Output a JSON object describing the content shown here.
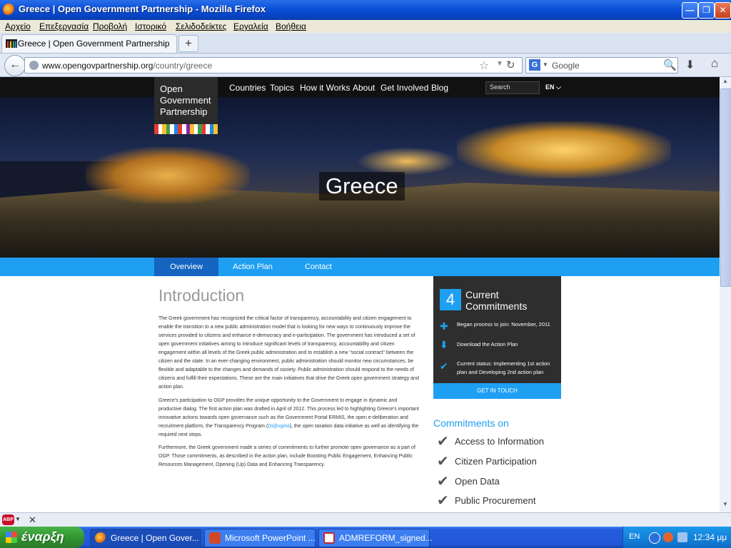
{
  "window": {
    "title": "Greece | Open Government Partnership - Mozilla Firefox",
    "controls": [
      "minimize",
      "maximize",
      "close"
    ]
  },
  "menubar": [
    "Αρχείο",
    "Επεξεργασία",
    "Προβολή",
    "Ιστορικό",
    "Σελιδοδείκτες",
    "Εργαλεία",
    "Βοήθεια"
  ],
  "tab": {
    "label": "Greece | Open Government Partnership",
    "new_tab": "+"
  },
  "navbar": {
    "url_host": "www.opengovpartnership.org",
    "url_path": "/country/greece",
    "search_placeholder": "Google",
    "search_engine": "G"
  },
  "site": {
    "logo": "Open Government Partnership",
    "nav": [
      "Countries",
      "Topics",
      "How it Works",
      "About",
      "Get Involved",
      "Blog"
    ],
    "search_placeholder": "Search",
    "lang": "EN",
    "hero_title": "Greece",
    "tabs": [
      "Overview",
      "Action Plan",
      "Contact"
    ],
    "active_tab": "Overview"
  },
  "intro": {
    "heading": "Introduction",
    "p1": "The Greek government has recognized the critical factor of transparency, accountability and citizen engagement to enable the transition to a new public administration model that is looking for new ways to continuously improve the services provided to citizens and enhance e-democracy and e-participation. The government has introduced a set of open government initiatives aiming to introduce significant levels of transparency, accountability and citizen engagement within all levels of the Greek public administration and to establish a new \"social contract\" between the citizen and the state. In an ever-changing environment, public administration should monitor new circumstances, be flexible and adaptable to the changes and demands of society. Public administration should respond to the needs of citizens and fulfill their expectations. These are the main initiatives that drive the Greek open government strategy and action plan.",
    "p2_a": "Greece's participation to OGP provides the unique opportunity to the Government to engage in dynamic and productive dialog. The first action plan was drafted in April of 2012. This process led to highlighting Greece's important innovative actions towards open governance such as the Government Portal ERMIS, the open e-deliberation and recruitment platform, the Transparency Program (",
    "p2_link": "Di@vgeia",
    "p2_b": "), the open taxation data initiative as well as identifying the required next steps.",
    "p3": "Furthermore, the Greek government made a series of commitments to further promote open governance as a part of OGP. Those commitments, as described in the action plan, include Boosting Public Engagement, Enhancing Public Resources Management, Opening (Up) Data and Enhancing Transparency."
  },
  "card": {
    "count": "4",
    "title_line1": "Current",
    "title_line2": "Commitments",
    "began": "Began process to join: November, 2011",
    "download": "Download the Action Plan",
    "status": "Current status: Implementing 1st action plan and Developing 2nd action plan",
    "cta": "GET IN TOUCH"
  },
  "commitments": {
    "heading": "Commitments on",
    "items": [
      "Access to Information",
      "Citizen Participation",
      "Open Data",
      "Public Procurement"
    ]
  },
  "addon": {
    "abp": "ABP"
  },
  "taskbar": {
    "start": "έναρξη",
    "tasks": [
      "Greece | Open Gover...",
      "Microsoft PowerPoint ...",
      "ADMREFORM_signed..."
    ],
    "lang": "EN",
    "clock": "12:34 μμ"
  },
  "colors": {
    "accent": "#1e9ff2",
    "active_tab": "#1565c0",
    "card": "#2e2e2e",
    "nav": "#111111"
  }
}
